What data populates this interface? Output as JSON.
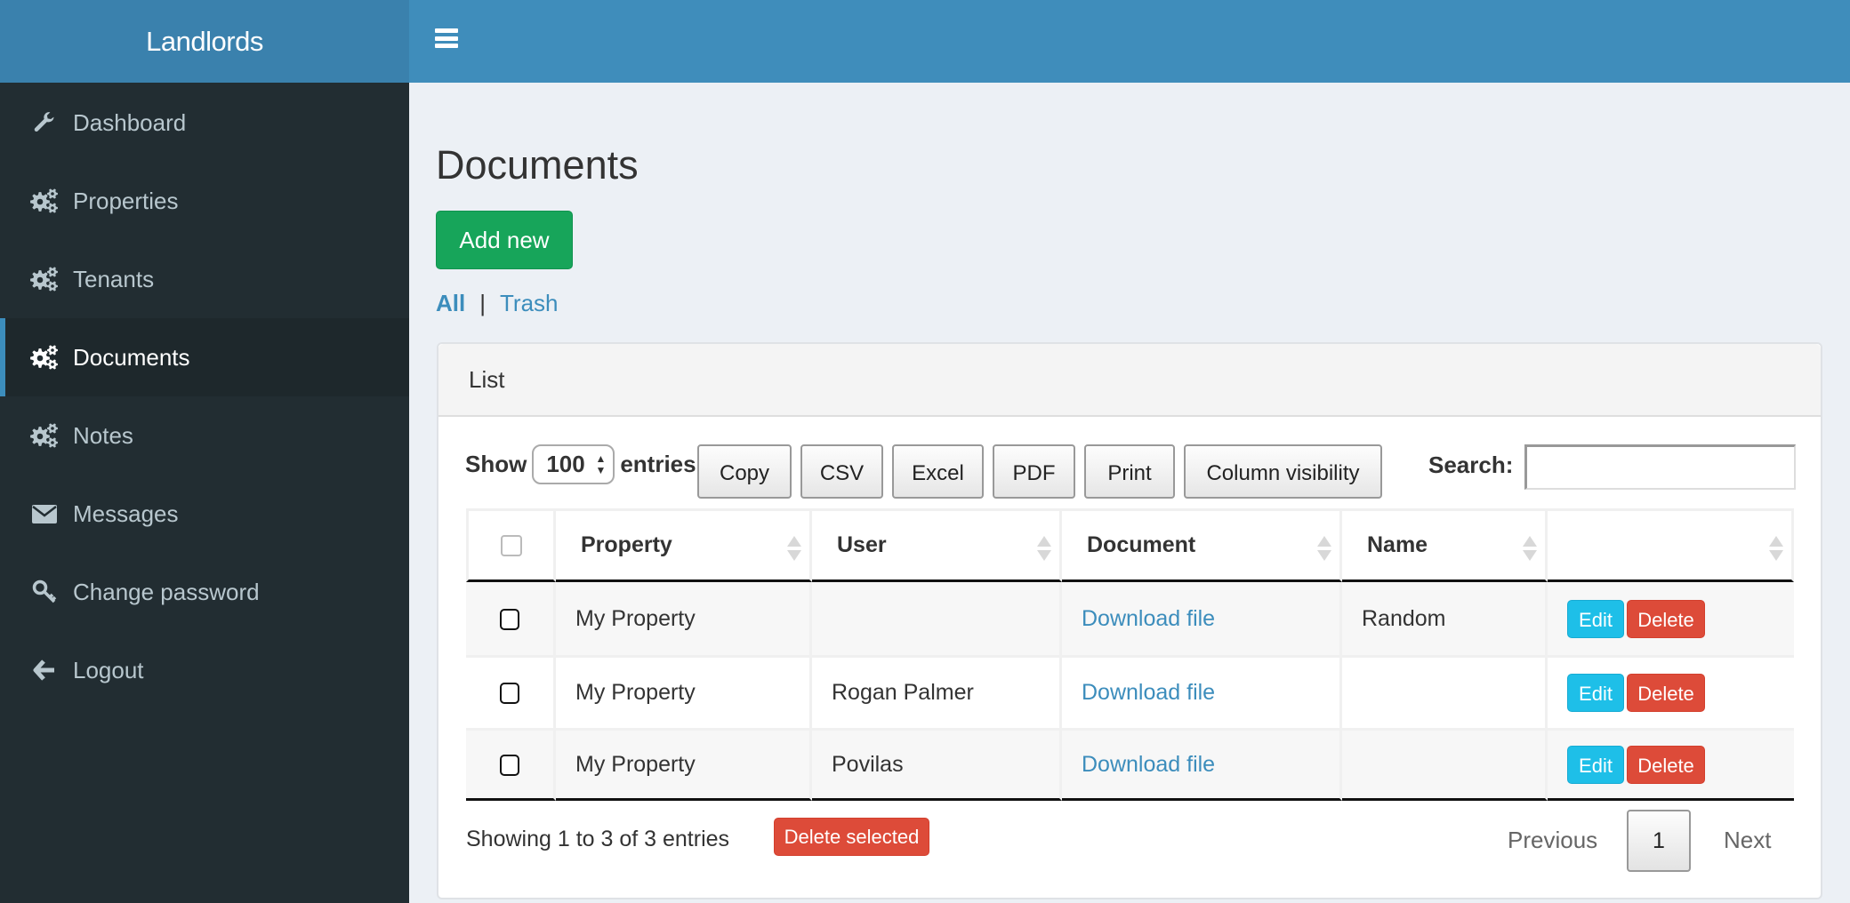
{
  "app": {
    "logo": "Landlords"
  },
  "header": {
    "menu_icon": "hamburger-icon"
  },
  "sidebar": {
    "active_color": "#3c8dbc",
    "items": [
      {
        "label": "Dashboard",
        "icon": "wrench-icon",
        "active": false
      },
      {
        "label": "Properties",
        "icon": "gears-icon",
        "active": false
      },
      {
        "label": "Tenants",
        "icon": "gears-icon",
        "active": false
      },
      {
        "label": "Documents",
        "icon": "gears-icon",
        "active": true
      },
      {
        "label": "Notes",
        "icon": "gears-icon",
        "active": false
      },
      {
        "label": "Messages",
        "icon": "envelope-icon",
        "active": false
      },
      {
        "label": "Change password",
        "icon": "key-icon",
        "active": false
      },
      {
        "label": "Logout",
        "icon": "arrow-left-icon",
        "active": false
      }
    ]
  },
  "main": {
    "title": "Documents",
    "add_button": "Add new",
    "filters": {
      "all": "All",
      "separator": "|",
      "trash": "Trash"
    },
    "panel": {
      "title": "List",
      "length": {
        "show": "Show",
        "value": "100",
        "entries": "entries"
      },
      "export_buttons": [
        "Copy",
        "CSV",
        "Excel",
        "PDF",
        "Print",
        "Column visibility"
      ],
      "search": {
        "label": "Search:",
        "value": "",
        "placeholder": ""
      },
      "columns": [
        "",
        "Property",
        "User",
        "Document",
        "Name",
        ""
      ],
      "rows": [
        {
          "checked": false,
          "property": "My Property",
          "user": "",
          "document": "Download file",
          "name": "Random",
          "edit": "Edit",
          "delete": "Delete"
        },
        {
          "checked": false,
          "property": "My Property",
          "user": "Rogan Palmer",
          "document": "Download file",
          "name": "",
          "edit": "Edit",
          "delete": "Delete"
        },
        {
          "checked": false,
          "property": "My Property",
          "user": "Povilas",
          "document": "Download file",
          "name": "",
          "edit": "Edit",
          "delete": "Delete"
        }
      ],
      "info": "Showing 1 to 3 of 3 entries",
      "delete_selected": "Delete selected",
      "pagination": {
        "previous": "Previous",
        "current": "1",
        "next": "Next"
      }
    }
  },
  "colors": {
    "header": "#3f8dbb",
    "logo_bg": "#3a81ad",
    "sidebar": "#222d32",
    "add": "#17a55a",
    "edit": "#1ebfe8",
    "delete": "#dd4b39",
    "link": "#3c8dbc"
  }
}
